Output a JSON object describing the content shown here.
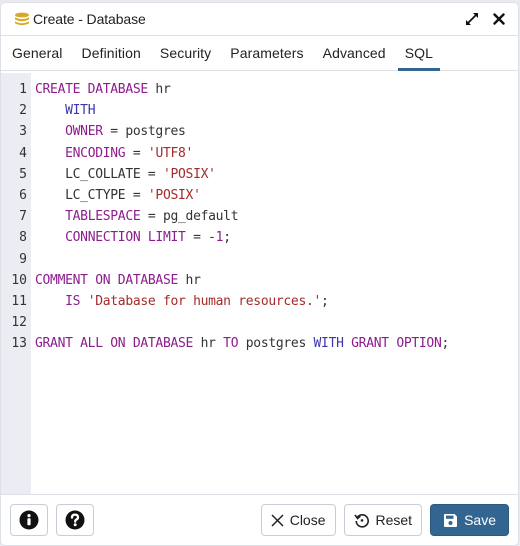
{
  "window": {
    "title": "Create - Database",
    "icon": "database-icon",
    "controls": [
      "maximize-icon",
      "close-icon"
    ]
  },
  "tabs": [
    {
      "label": "General",
      "active": false
    },
    {
      "label": "Definition",
      "active": false
    },
    {
      "label": "Security",
      "active": false
    },
    {
      "label": "Parameters",
      "active": false
    },
    {
      "label": "Advanced",
      "active": false
    },
    {
      "label": "SQL",
      "active": true
    }
  ],
  "sql": {
    "line_numbers": [
      "1",
      "2",
      "3",
      "4",
      "5",
      "6",
      "7",
      "8",
      "9",
      "10",
      "11",
      "12",
      "13"
    ],
    "lines": [
      [
        {
          "t": "CREATE DATABASE",
          "c": "kw"
        },
        {
          "t": " hr",
          "c": ""
        }
      ],
      [
        {
          "t": "    ",
          "c": ""
        },
        {
          "t": "WITH",
          "c": "kw2"
        }
      ],
      [
        {
          "t": "    ",
          "c": ""
        },
        {
          "t": "OWNER",
          "c": "kw"
        },
        {
          "t": " = postgres",
          "c": ""
        }
      ],
      [
        {
          "t": "    ",
          "c": ""
        },
        {
          "t": "ENCODING",
          "c": "kw"
        },
        {
          "t": " = ",
          "c": ""
        },
        {
          "t": "'UTF8'",
          "c": "str"
        }
      ],
      [
        {
          "t": "    LC_COLLATE = ",
          "c": ""
        },
        {
          "t": "'POSIX'",
          "c": "str"
        }
      ],
      [
        {
          "t": "    LC_CTYPE = ",
          "c": ""
        },
        {
          "t": "'POSIX'",
          "c": "str"
        }
      ],
      [
        {
          "t": "    ",
          "c": ""
        },
        {
          "t": "TABLESPACE",
          "c": "kw"
        },
        {
          "t": " = pg_default",
          "c": ""
        }
      ],
      [
        {
          "t": "    ",
          "c": ""
        },
        {
          "t": "CONNECTION LIMIT",
          "c": "kw"
        },
        {
          "t": " = -",
          "c": ""
        },
        {
          "t": "1",
          "c": "num"
        },
        {
          "t": ";",
          "c": ""
        }
      ],
      [],
      [
        {
          "t": "COMMENT ON DATABASE",
          "c": "kw"
        },
        {
          "t": " hr",
          "c": ""
        }
      ],
      [
        {
          "t": "    ",
          "c": ""
        },
        {
          "t": "IS",
          "c": "kw"
        },
        {
          "t": " ",
          "c": ""
        },
        {
          "t": "'Database for human resources.'",
          "c": "str"
        },
        {
          "t": ";",
          "c": ""
        }
      ],
      [],
      [
        {
          "t": "GRANT ALL ON DATABASE",
          "c": "kw"
        },
        {
          "t": " hr ",
          "c": ""
        },
        {
          "t": "TO",
          "c": "kw"
        },
        {
          "t": " postgres ",
          "c": ""
        },
        {
          "t": "WITH",
          "c": "kw2"
        },
        {
          "t": " ",
          "c": ""
        },
        {
          "t": "GRANT OPTION",
          "c": "kw"
        },
        {
          "t": ";",
          "c": ""
        }
      ]
    ]
  },
  "footer": {
    "info_icon": "info-icon",
    "help_icon": "help-icon",
    "close_label": "Close",
    "reset_label": "Reset",
    "save_label": "Save"
  },
  "colors": {
    "accent": "#326690",
    "keyword": "#8d1c8d",
    "keyword_alt": "#3d36b0",
    "string": "#a42b2b"
  }
}
